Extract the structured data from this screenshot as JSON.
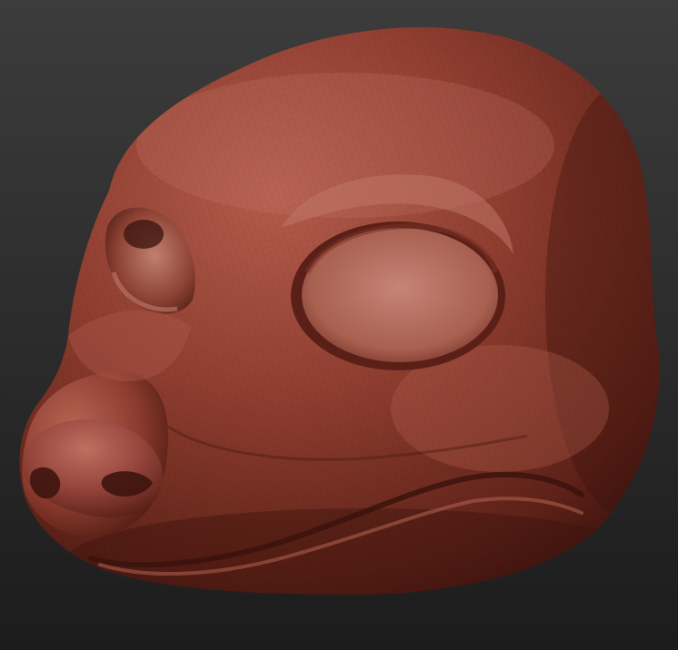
{
  "viewport": {
    "background_top": "#3c3c3c",
    "background_bottom": "#1c1c1c"
  },
  "model": {
    "subject": "sculpted-animal-head-mask",
    "base_color": "#8a3a2c",
    "highlight_color": "#c27a6c",
    "shadow_color": "#3f140e",
    "wireframe_visible": true
  }
}
